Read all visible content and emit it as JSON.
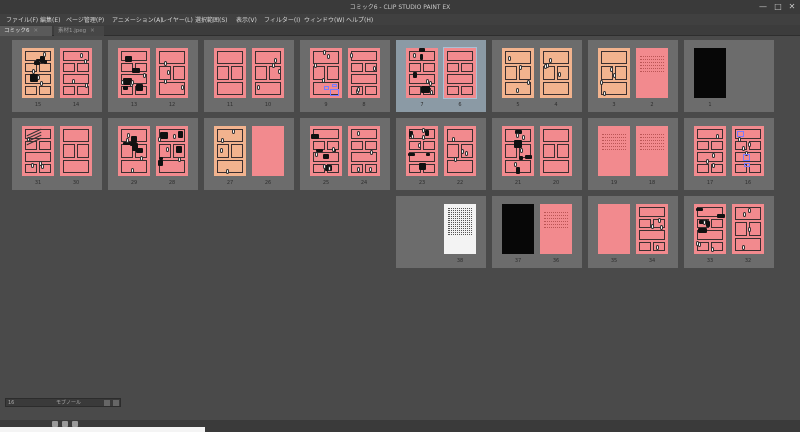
{
  "window": {
    "title": "コミック6 - CLIP STUDIO PAINT EX",
    "minimize": "—",
    "maximize": "□",
    "close": "✕"
  },
  "menu": [
    "ファイル(F)",
    "編集(E)",
    "ページ管理(P)",
    "アニメーション(A)",
    "レイヤー(L)",
    "選択範囲(S)",
    "表示(V)",
    "フィルター(I)",
    "ウィンドウ(W)",
    "ヘルプ(H)"
  ],
  "tabs": [
    {
      "label": "コミック6",
      "active": true
    },
    {
      "label": "素材1.jpeg",
      "active": false
    }
  ],
  "navigator": {
    "value": "16",
    "mode": "モブノール"
  },
  "spreads": [
    {
      "row": 0,
      "col": 0,
      "left": {
        "num": "15",
        "style": "peach-bw"
      },
      "right": {
        "num": "14",
        "style": "pink-panels"
      }
    },
    {
      "row": 0,
      "col": 1,
      "left": {
        "num": "13",
        "style": "pink-bw"
      },
      "right": {
        "num": "12",
        "style": "pink-bubbles"
      }
    },
    {
      "row": 0,
      "col": 2,
      "left": {
        "num": "11",
        "style": "pink-sketch"
      },
      "right": {
        "num": "10",
        "style": "pink-panels"
      }
    },
    {
      "row": 0,
      "col": 3,
      "left": {
        "num": "9",
        "style": "pink-blue"
      },
      "right": {
        "num": "8",
        "style": "pink-bubbles"
      }
    },
    {
      "row": 0,
      "col": 4,
      "left": {
        "num": "7",
        "style": "pink-bw"
      },
      "right": {
        "num": "6",
        "style": "pink-sketch"
      },
      "selected": true
    },
    {
      "row": 0,
      "col": 5,
      "left": {
        "num": "5",
        "style": "peach-panels"
      },
      "right": {
        "num": "4",
        "style": "peach-panels"
      }
    },
    {
      "row": 0,
      "col": 6,
      "left": {
        "num": "3",
        "style": "peach-panels"
      },
      "right": {
        "num": "2",
        "style": "pink-text"
      }
    },
    {
      "row": 0,
      "col": 7,
      "left": {
        "num": "1",
        "style": "black"
      },
      "right": {
        "num": "",
        "style": "blank"
      }
    },
    {
      "row": 1,
      "col": 0,
      "left": {
        "num": "31",
        "style": "pink-scribble"
      },
      "right": {
        "num": "30",
        "style": "pink-sketch"
      }
    },
    {
      "row": 1,
      "col": 1,
      "left": {
        "num": "29",
        "style": "pink-bw"
      },
      "right": {
        "num": "28",
        "style": "pink-bw"
      }
    },
    {
      "row": 1,
      "col": 2,
      "left": {
        "num": "27",
        "style": "peach-panels"
      },
      "right": {
        "num": "26",
        "style": "pink-plain"
      }
    },
    {
      "row": 1,
      "col": 3,
      "left": {
        "num": "25",
        "style": "pink-bw"
      },
      "right": {
        "num": "24",
        "style": "pink-bubbles"
      }
    },
    {
      "row": 1,
      "col": 4,
      "left": {
        "num": "23",
        "style": "pink-bw"
      },
      "right": {
        "num": "22",
        "style": "pink-panels"
      }
    },
    {
      "row": 1,
      "col": 5,
      "left": {
        "num": "21",
        "style": "pink-bw"
      },
      "right": {
        "num": "20",
        "style": "pink-sketch"
      }
    },
    {
      "row": 1,
      "col": 6,
      "left": {
        "num": "19",
        "style": "pink-text"
      },
      "right": {
        "num": "18",
        "style": "pink-text"
      }
    },
    {
      "row": 1,
      "col": 7,
      "left": {
        "num": "17",
        "style": "pink-panels"
      },
      "right": {
        "num": "16",
        "style": "pink-blue"
      }
    },
    {
      "row": 2,
      "col": 4,
      "left": {
        "num": "",
        "style": "blank"
      },
      "right": {
        "num": "38",
        "style": "white-text"
      }
    },
    {
      "row": 2,
      "col": 5,
      "left": {
        "num": "37",
        "style": "black"
      },
      "right": {
        "num": "36",
        "style": "pink-text"
      }
    },
    {
      "row": 2,
      "col": 6,
      "left": {
        "num": "35",
        "style": "pink-plain"
      },
      "right": {
        "num": "34",
        "style": "pink-bubbles"
      }
    },
    {
      "row": 2,
      "col": 7,
      "left": {
        "num": "33",
        "style": "pink-bw"
      },
      "right": {
        "num": "32",
        "style": "pink-bubbles"
      }
    }
  ]
}
